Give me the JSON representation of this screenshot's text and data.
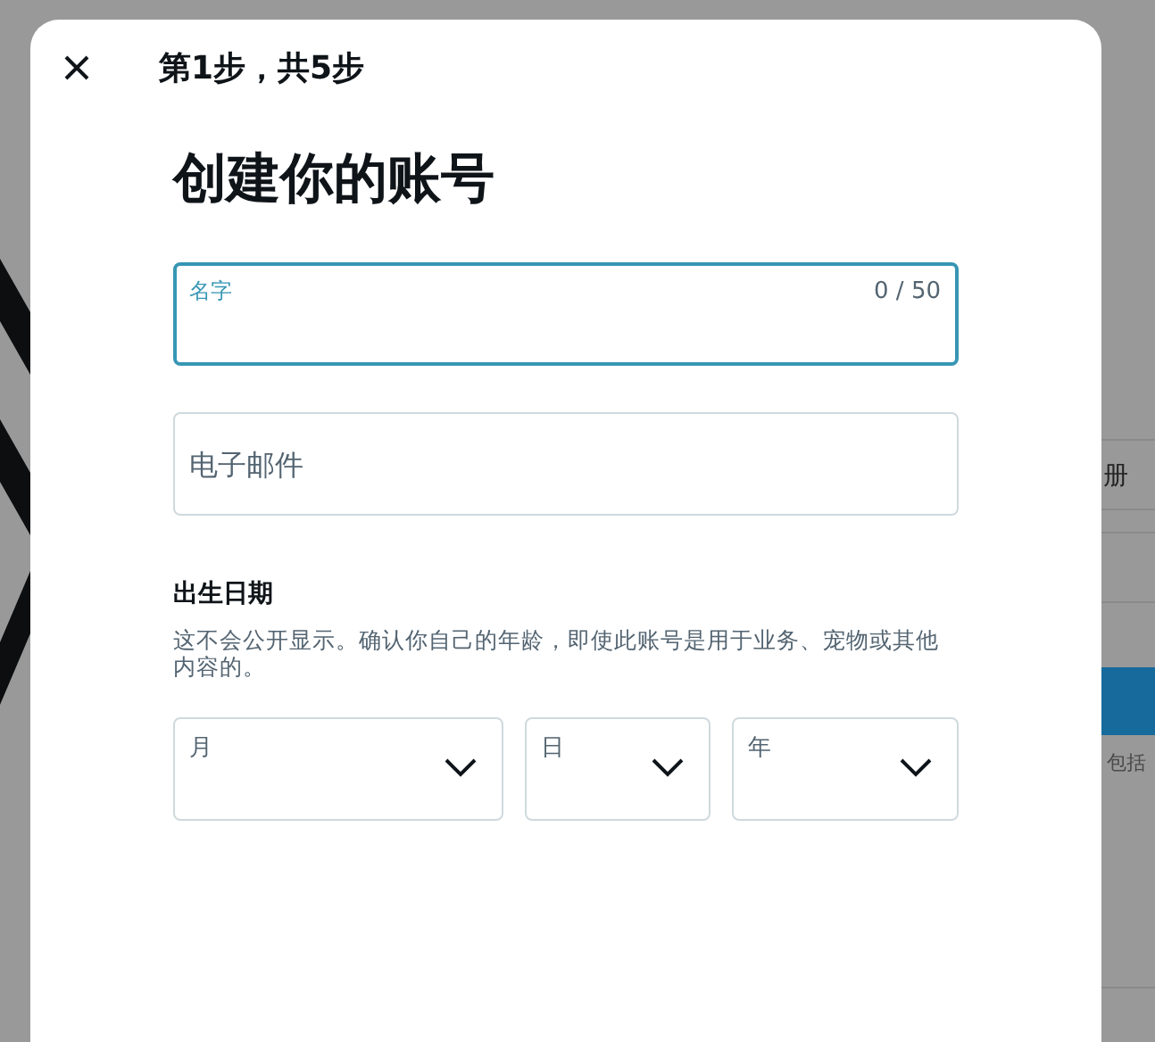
{
  "background_page": {
    "side_text": "册",
    "note_text": "包括"
  },
  "dialog": {
    "step": "第1步，共5步",
    "title": "创建你的账号",
    "name_field": {
      "label": "名字",
      "counter": "0 / 50",
      "focused": true
    },
    "email_field": {
      "placeholder": "电子邮件",
      "focused": false
    },
    "birthdate": {
      "heading": "出生日期",
      "note": "这不会公开显示。确认你自己的年龄，即使此账号是用于业务、宠物或其他内容的。",
      "selects": [
        {
          "label": "月"
        },
        {
          "label": "日"
        },
        {
          "label": "年"
        }
      ]
    }
  }
}
